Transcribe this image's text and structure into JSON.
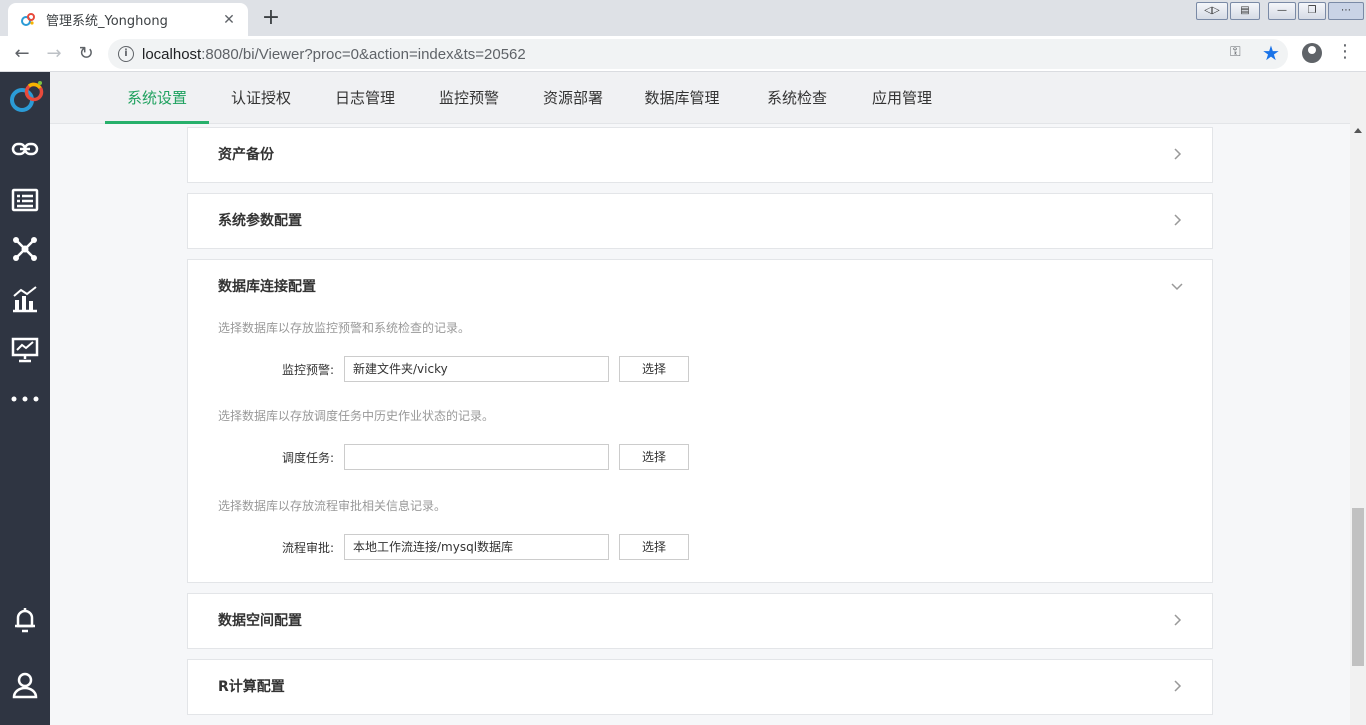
{
  "browser": {
    "tab_title": "管理系统_Yonghong",
    "url_host": "localhost",
    "url_rest": ":8080/bi/Viewer?proc=0&action=index&ts=20562"
  },
  "nav": {
    "tabs": [
      {
        "label": "系统设置",
        "active": true
      },
      {
        "label": "认证授权"
      },
      {
        "label": "日志管理"
      },
      {
        "label": "监控预警"
      },
      {
        "label": "资源部署"
      },
      {
        "label": "数据库管理"
      },
      {
        "label": "系统检查"
      },
      {
        "label": "应用管理"
      }
    ]
  },
  "panels": {
    "asset_backup": {
      "title": "资产备份"
    },
    "sys_params": {
      "title": "系统参数配置"
    },
    "db_conn": {
      "title": "数据库连接配置",
      "desc1": "选择数据库以存放监控预警和系统检查的记录。",
      "label1": "监控预警:",
      "value1": "新建文件夹/vicky",
      "desc2": "选择数据库以存放调度任务中历史作业状态的记录。",
      "label2": "调度任务:",
      "value2": "",
      "desc3": "选择数据库以存放流程审批相关信息记录。",
      "label3": "流程审批:",
      "value3": "本地工作流连接/mysql数据库",
      "select_label": "选择"
    },
    "data_space": {
      "title": "数据空间配置"
    },
    "r_compute": {
      "title": "R计算配置"
    }
  },
  "icons": {
    "sidebar": [
      "link-icon",
      "list-icon",
      "network-icon",
      "chart-icon",
      "presentation-icon",
      "more-icon",
      "bell-icon",
      "user-icon"
    ]
  },
  "colors": {
    "accent": "#27b06b",
    "sidebar_bg": "#2f3542"
  }
}
